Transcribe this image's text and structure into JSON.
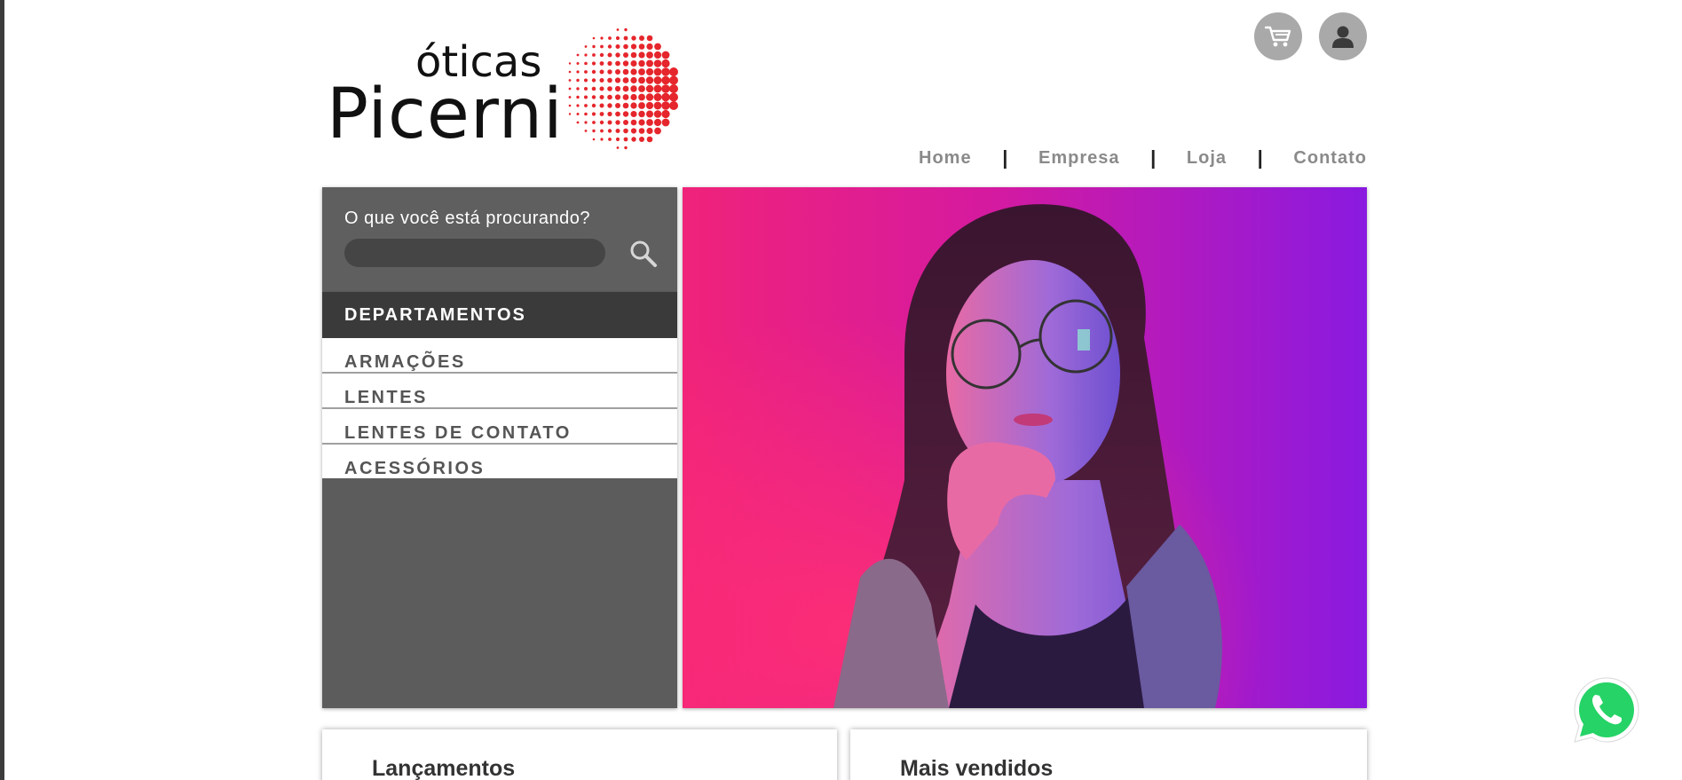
{
  "brand": {
    "line1": "óticas",
    "line2": "Picerni",
    "accent_color": "#e5262c"
  },
  "header_icons": {
    "cart": "cart-icon",
    "user": "user-icon"
  },
  "nav": {
    "items": [
      "Home",
      "Empresa",
      "Loja",
      "Contato"
    ],
    "separator": "|"
  },
  "search": {
    "label": "O que você está procurando?",
    "value": "",
    "icon": "search-icon"
  },
  "departments": {
    "title": "DEPARTAMENTOS",
    "items": [
      "ARMAÇÕES",
      "LENTES",
      "LENTES DE CONTATO",
      "ACESSÓRIOS"
    ]
  },
  "sections": {
    "left": "Lançamentos",
    "right": "Mais vendidos"
  },
  "whatsapp": {
    "icon": "whatsapp-icon",
    "color": "#25d366"
  }
}
